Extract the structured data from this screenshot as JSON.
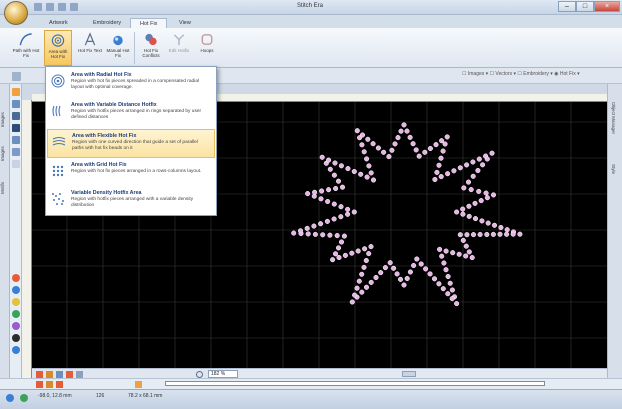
{
  "window": {
    "title": "Stitch Era"
  },
  "tabs": [
    "Artwork",
    "Embroidery",
    "Hot Fix",
    "View"
  ],
  "active_tab": 2,
  "ribbon": [
    {
      "label": "Path with Hot Fix",
      "icon": "path-hotfix-icon"
    },
    {
      "label": "Area with Hot Fix",
      "icon": "area-hotfix-icon",
      "selected": true
    },
    {
      "label": "Hot Fix Text",
      "icon": "text-a-icon"
    },
    {
      "label": "Manual Hot Fix",
      "icon": "manual-hotfix-icon"
    },
    {
      "label": "Hot Fix Conflicts",
      "icon": "conflicts-icon"
    },
    {
      "label": "Edit Hotfix",
      "icon": "edit-hotfix-icon"
    },
    {
      "label": "Hoops",
      "icon": "hoop-icon"
    }
  ],
  "view_tabs": "☐ Images ▾  ☐ Vectors ▾  ☐ Embroidery ▾  ◉ Hot Fix ▾",
  "left_tabs": [
    "Images",
    "Images",
    "Motifs"
  ],
  "right_tabs": [
    "Object Manager",
    "Style"
  ],
  "dropdown": [
    {
      "title": "Area with Radial Hot Fix",
      "desc": "Region with hot fix pieces spreaded in a compensated radial layout with optimal coverage."
    },
    {
      "title": "Area with Variable Distance Hotfix",
      "desc": "Region with hotfix pieces arranged in rings separated by user defined distances"
    },
    {
      "title": "Area with Flexible Hot Fix",
      "desc": "Region with one curved direction that guide a set of parallel paths with hot fix beads on it"
    },
    {
      "title": "Area with Grid Hot Fix",
      "desc": "Region with hot fix pieces arranged in a rows-columns layout."
    },
    {
      "title": "Variable Density Hotfix Area",
      "desc": "Region with hotfix pieces arranged with a variable density distribution"
    }
  ],
  "highlighted_item": 2,
  "zoom": "182 %",
  "status": {
    "coords": "-98.0, 12.8 mm",
    "count": "126",
    "size": "78.2 x 68.1 mm"
  },
  "colors": {
    "canvas": "#000000",
    "bead": "#e8b4e6",
    "accent": "#f6c75c"
  }
}
